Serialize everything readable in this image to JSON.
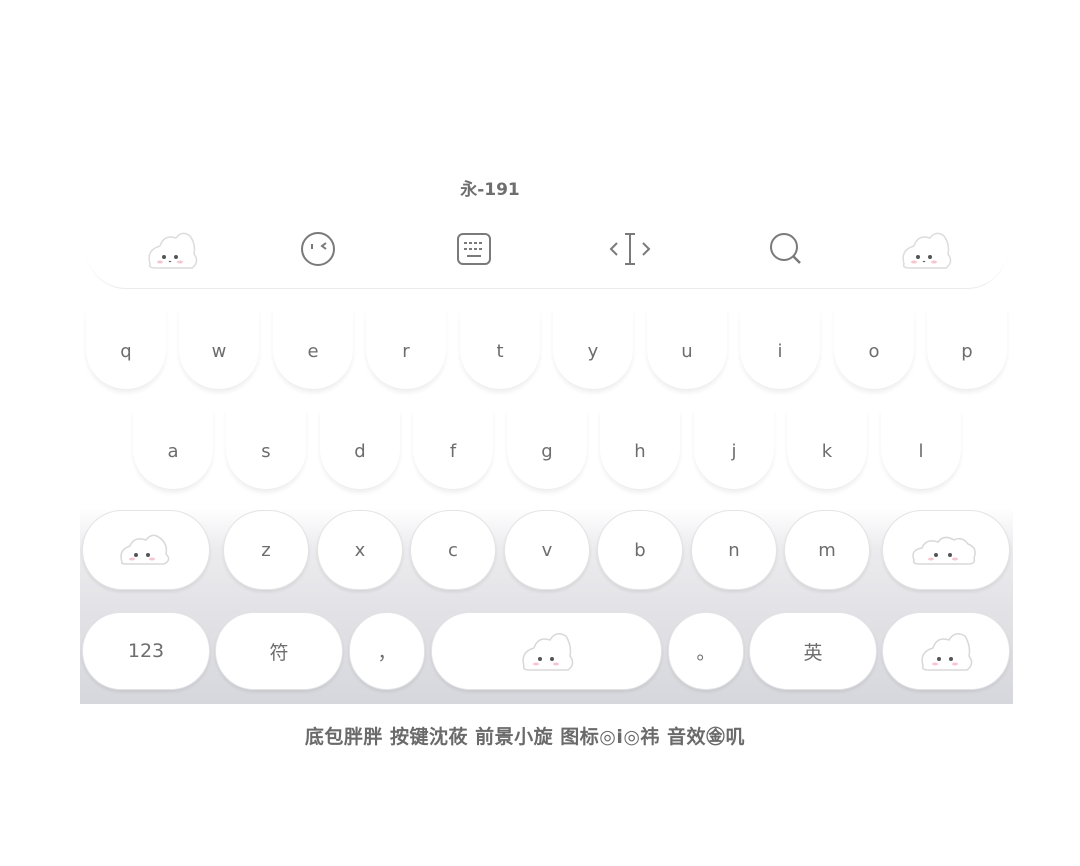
{
  "id_label": "永-191",
  "toolbar": {
    "items": [
      {
        "name": "left-mascot-icon"
      },
      {
        "name": "emoji-icon"
      },
      {
        "name": "keyboard-icon"
      },
      {
        "name": "cursor-icon"
      },
      {
        "name": "search-icon"
      },
      {
        "name": "right-mascot-icon"
      }
    ]
  },
  "rows": {
    "row1": [
      "q",
      "w",
      "e",
      "r",
      "t",
      "y",
      "u",
      "i",
      "o",
      "p"
    ],
    "row2": [
      "a",
      "s",
      "d",
      "f",
      "g",
      "h",
      "j",
      "k",
      "l"
    ],
    "row3": [
      "z",
      "x",
      "c",
      "v",
      "b",
      "n",
      "m"
    ]
  },
  "bottom": {
    "numbers": "123",
    "symbols": "符",
    "comma": "，",
    "period": "。",
    "lang": "英"
  },
  "caption": "底包胖胖 按键沈莜 前景小旋 图标◎i◎祎 音效㊎叽",
  "colors": {
    "key_bg": "#ffffff",
    "key_text": "#6d6d6d",
    "keyboard_bottom": "#d6d7dc"
  }
}
